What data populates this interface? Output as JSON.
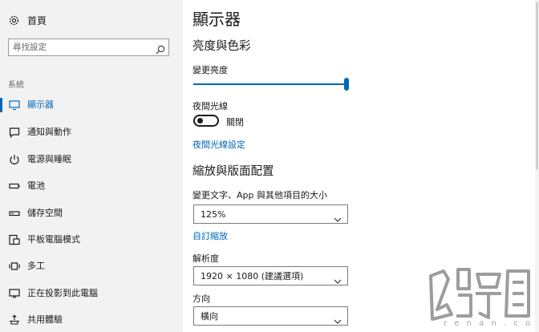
{
  "sidebar": {
    "home": {
      "label": "首頁",
      "icon": "gear-icon"
    },
    "search": {
      "placeholder": "尋找設定",
      "icon": "search-icon"
    },
    "section_label": "系統",
    "items": [
      {
        "label": "顯示器",
        "icon": "monitor-icon",
        "active": true
      },
      {
        "label": "通知與動作",
        "icon": "notification-icon"
      },
      {
        "label": "電源與睡眠",
        "icon": "power-icon"
      },
      {
        "label": "電池",
        "icon": "battery-icon"
      },
      {
        "label": "儲存空間",
        "icon": "storage-icon"
      },
      {
        "label": "平板電腦模式",
        "icon": "tablet-mode-icon"
      },
      {
        "label": "多工",
        "icon": "multitasking-icon"
      },
      {
        "label": "正在投影到此電腦",
        "icon": "projecting-icon"
      },
      {
        "label": "共用體驗",
        "icon": "shared-experiences-icon"
      }
    ]
  },
  "main": {
    "title": "顯示器",
    "brightness_color": {
      "heading": "亮度與色彩",
      "brightness_label": "變更亮度",
      "brightness_level": 1.0,
      "night_light_label": "夜間光線",
      "night_light_state": "關閉",
      "night_light_settings_link": "夜間光線設定"
    },
    "scale_layout": {
      "heading": "縮放與版面配置",
      "scale_label": "變更文字、App 與其他項目的大小",
      "scale_value": "125%",
      "custom_scaling_link": "自訂縮放",
      "resolution_label": "解析度",
      "resolution_value": "1920 × 1080 (建議選項)",
      "orientation_label": "方向",
      "orientation_value": "橫向"
    }
  },
  "watermark": {
    "text": "电脑百事网",
    "url": "renan.com"
  },
  "colors": {
    "accent": "#0068b8",
    "sidebar_bg": "#f2f2f2",
    "text": "#1a1a1a"
  }
}
